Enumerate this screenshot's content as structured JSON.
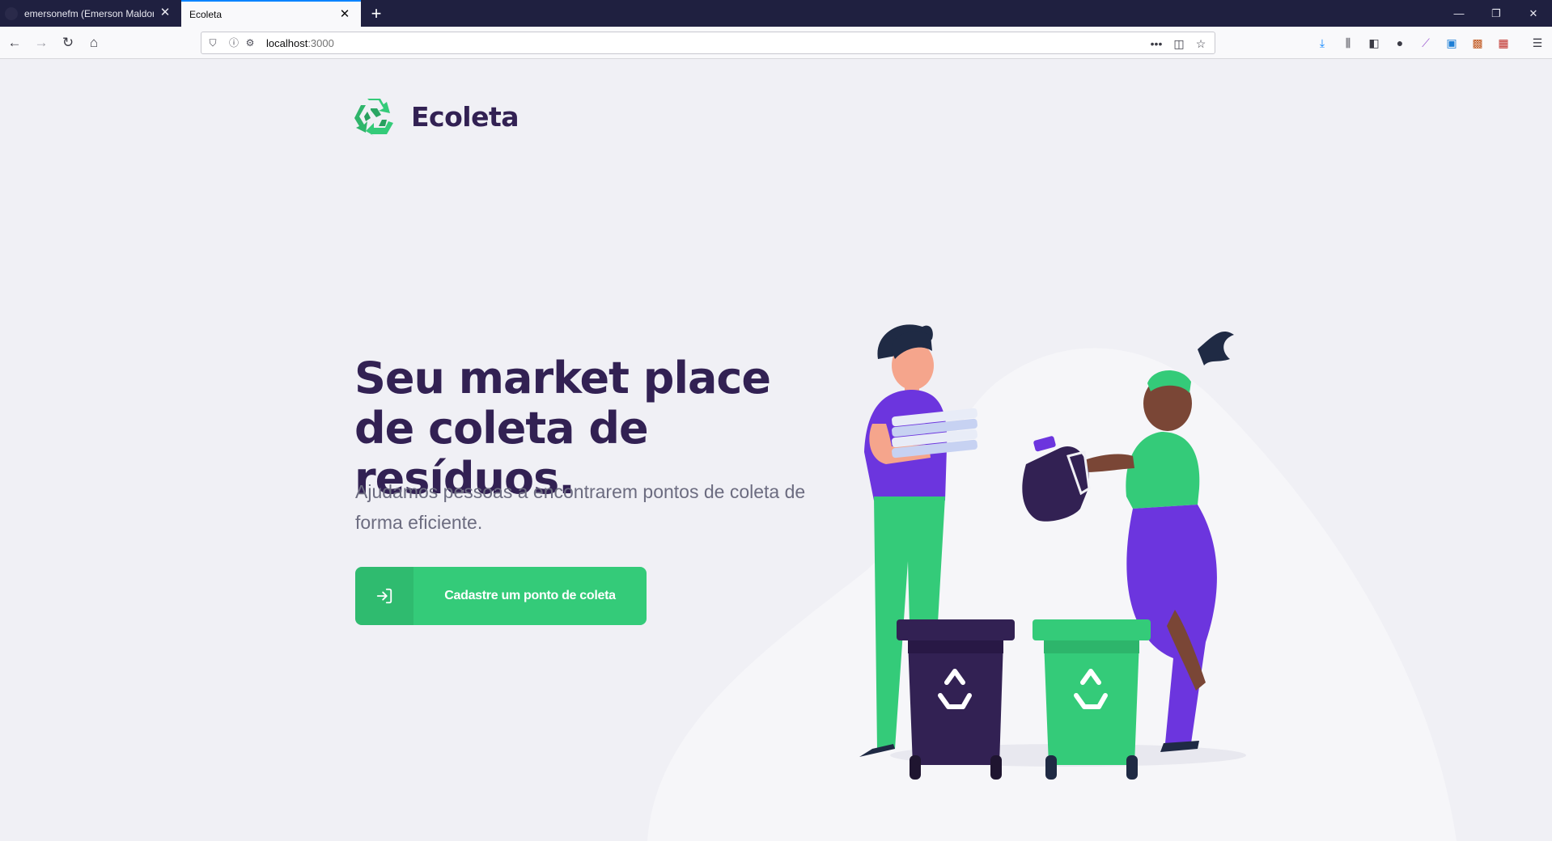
{
  "browser": {
    "tabs": [
      {
        "title": "emersonefm (Emerson Maldonado)",
        "active": false
      },
      {
        "title": "Ecoleta",
        "active": true
      }
    ],
    "new_tab_symbol": "+",
    "url": {
      "host": "localhost",
      "port": ":3000"
    },
    "icons": [
      "back-icon",
      "forward-icon",
      "reload-icon",
      "home-icon",
      "shield-icon",
      "info-icon",
      "permissions-icon",
      "more-icon",
      "pocket-icon",
      "bookmark-star-icon",
      "download-icon",
      "library-icon",
      "sidebar-icon",
      "account-icon",
      "extension-icon",
      "menu-icon"
    ]
  },
  "page": {
    "brand": "Ecoleta",
    "hero_title": "Seu market place de coleta de resíduos.",
    "hero_text": "Ajudamos pessoas a encontrarem pontos de coleta de forma eficiente.",
    "cta_label": "Cadastre um ponto de coleta"
  },
  "colors": {
    "primary": "#34cb79",
    "title": "#322153",
    "text": "#6c6c80",
    "background": "#f0f0f5",
    "accent_purple": "#6c35de"
  }
}
